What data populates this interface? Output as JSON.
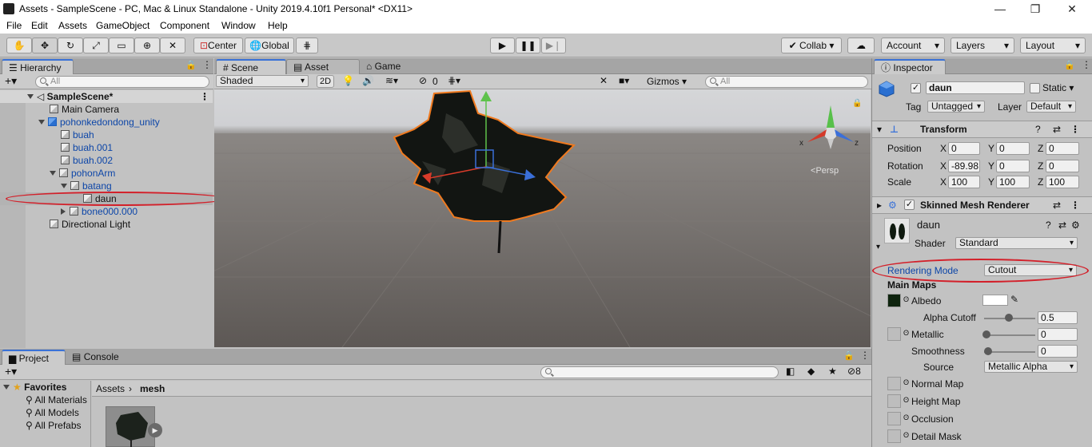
{
  "window": {
    "title": "Assets - SampleScene - PC, Mac & Linux Standalone - Unity 2019.4.10f1 Personal* <DX11>",
    "minimize": "—",
    "maximize": "❐",
    "close": "✕"
  },
  "menu": [
    "File",
    "Edit",
    "Assets",
    "GameObject",
    "Component",
    "Window",
    "Help"
  ],
  "toolbar": {
    "pivot": "Center",
    "space": "Global",
    "collab": "Collab",
    "account": "Account",
    "layers": "Layers",
    "layout": "Layout"
  },
  "hierarchy": {
    "tab": "Hierarchy",
    "search_placeholder": "All",
    "scene": "SampleScene*",
    "items": [
      {
        "label": "Main Camera"
      },
      {
        "label": "pohonkedondong_unity"
      },
      {
        "label": "buah"
      },
      {
        "label": "buah.001"
      },
      {
        "label": "buah.002"
      },
      {
        "label": "pohonArm"
      },
      {
        "label": "batang"
      },
      {
        "label": "daun"
      },
      {
        "label": "bone000.000"
      },
      {
        "label": "Directional Light"
      }
    ]
  },
  "scene": {
    "tabs": [
      "Scene",
      "Asset Store",
      "Game"
    ],
    "shading": "Shaded",
    "mode2d": "2D",
    "fx_count": "0",
    "gizmos": "Gizmos",
    "search_placeholder": "All",
    "persp": "Persp",
    "axis_x": "x",
    "axis_z": "z"
  },
  "project": {
    "tabs": [
      "Project",
      "Console"
    ],
    "favorites": "Favorites",
    "fav_items": [
      "All Materials",
      "All Models",
      "All Prefabs"
    ],
    "breadcrumb": [
      "Assets",
      "mesh"
    ],
    "hidden_count": "8"
  },
  "inspector": {
    "tab": "Inspector",
    "object_name": "daun",
    "static": "Static",
    "tag_label": "Tag",
    "tag": "Untagged",
    "layer_label": "Layer",
    "layer": "Default",
    "transform": {
      "title": "Transform",
      "rows": [
        {
          "label": "Position",
          "x": "0",
          "y": "0",
          "z": "0"
        },
        {
          "label": "Rotation",
          "x": "-89.98",
          "y": "0",
          "z": "0"
        },
        {
          "label": "Scale",
          "x": "100",
          "y": "100",
          "z": "100"
        }
      ]
    },
    "skinned": "Skinned Mesh Renderer",
    "material": {
      "name": "daun",
      "shader_label": "Shader",
      "shader": "Standard",
      "rendering_mode_label": "Rendering Mode",
      "rendering_mode": "Cutout",
      "main_maps": "Main Maps",
      "albedo": "Albedo",
      "alpha_cutoff_label": "Alpha Cutoff",
      "alpha_cutoff": "0.5",
      "metallic_label": "Metallic",
      "metallic": "0",
      "smoothness_label": "Smoothness",
      "smoothness": "0",
      "source_label": "Source",
      "source": "Metallic Alpha",
      "normal_map": "Normal Map",
      "height_map": "Height Map",
      "occlusion": "Occlusion",
      "detail_mask": "Detail Mask"
    }
  },
  "colors": {
    "highlight": "#d3202a",
    "selection_outline": "#f07a1f",
    "prefab_blue": "#0d46a8"
  }
}
